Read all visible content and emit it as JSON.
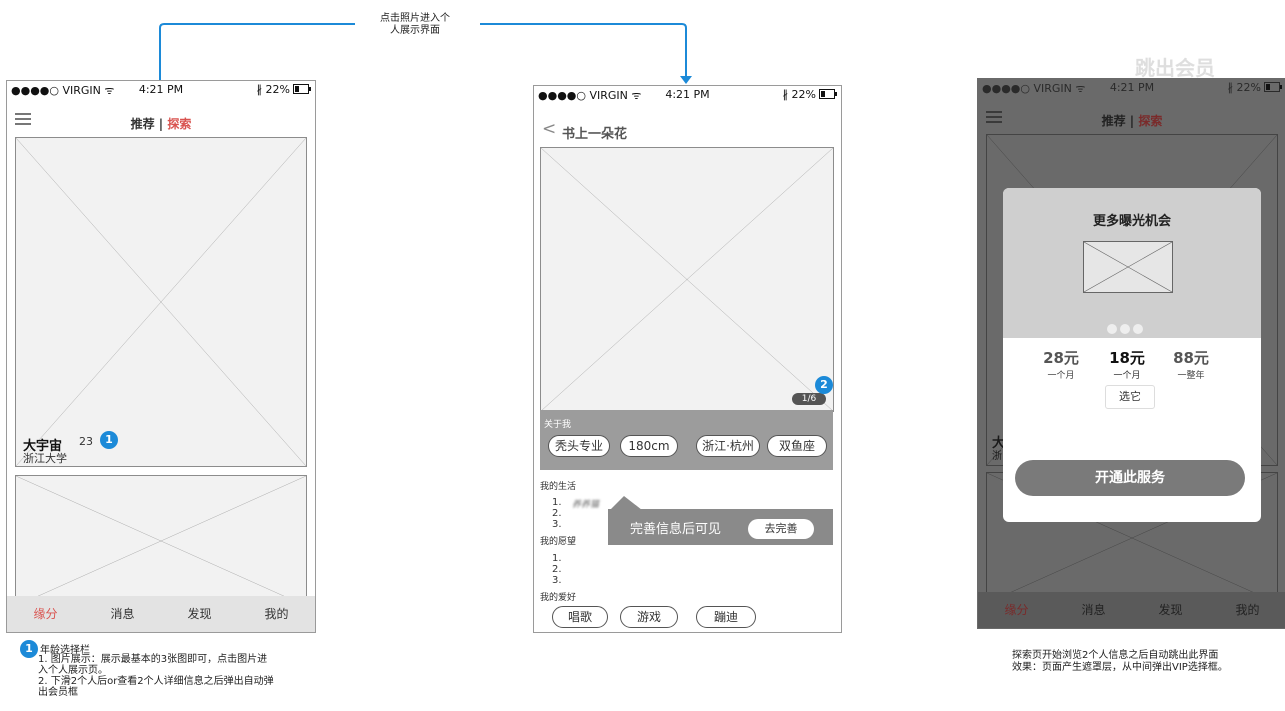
{
  "flow": {
    "click_note": "点击照片进入个\n人展示界面",
    "jump_label": "跳出会员",
    "accent_blue": "#1c8ad8"
  },
  "status_bar": {
    "carrier": "●●●●○ VIRGIN ᯤ",
    "time": "4:21 PM",
    "battery": "∦ 22%"
  },
  "screen1": {
    "tab_recommend": "推荐",
    "tab_sep": "|",
    "tab_explore": "探索",
    "card_name": "大宇宙",
    "card_age": "23",
    "card_school": "浙江大学",
    "badge": "1",
    "nav": [
      "缘分",
      "消息",
      "发现",
      "我的"
    ],
    "note_title": "年龄选择栏",
    "note_lines": [
      "1. 图片展示：展示最基本的3张图即可，点击图片进",
      "入个人展示页。",
      "2. 下滑2个人后or查看2个人详细信息之后弹出自动弹",
      "出会员框"
    ]
  },
  "screen2": {
    "back": "<",
    "title": "书上一朵花",
    "page_indicator": "1/6",
    "badge": "2",
    "about_label": "关于我",
    "tags": [
      "秃头专业",
      "180cm",
      "浙江·杭州",
      "双鱼座"
    ],
    "life_label": "我的生活",
    "life_items": [
      "1.",
      "2.",
      "3."
    ],
    "blurred": "养养猫",
    "wish_label": "我的愿望",
    "wish_items": [
      "1.",
      "2.",
      "3."
    ],
    "hobby_label": "我的爱好",
    "hobbies": [
      "唱歌",
      "游戏",
      "蹦迪"
    ],
    "tip_text": "完善信息后可见",
    "tip_button": "去完善"
  },
  "screen3": {
    "tab_recommend": "推荐",
    "tab_sep": "|",
    "tab_explore": "探索",
    "card_name_partial": "大",
    "card_school_partial": "浙",
    "modal_title": "更多曝光机会",
    "plans": [
      {
        "price": "28元",
        "period": "一个月"
      },
      {
        "price": "18元",
        "period": "一个月"
      },
      {
        "price": "88元",
        "period": "一整年"
      }
    ],
    "select_button": "选它",
    "open_button": "开通此服务",
    "nav": [
      "缘分",
      "消息",
      "发现",
      "我的"
    ],
    "note_lines": [
      "探索页开始浏览2个人信息之后自动跳出此界面",
      "效果：页面产生遮罩层，从中间弹出VIP选择框。"
    ]
  }
}
